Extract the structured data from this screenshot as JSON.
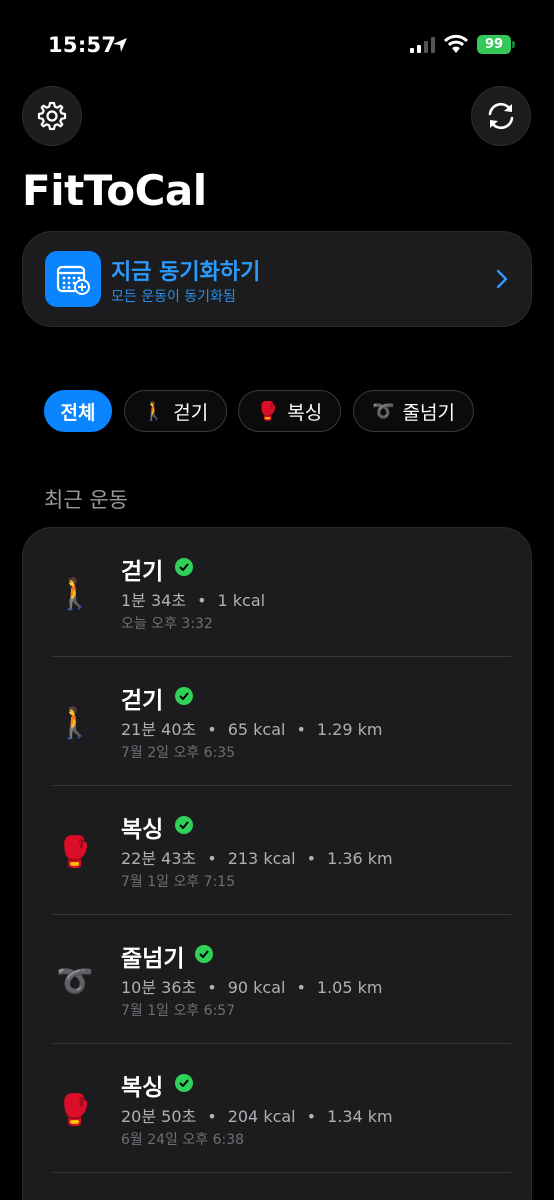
{
  "status_bar": {
    "time": "15:57",
    "battery": "99"
  },
  "header": {
    "title": "FitToCal",
    "settings_icon": "gear-icon",
    "sync_icon": "refresh-icon"
  },
  "sync_card": {
    "title": "지금 동기화하기",
    "subtitle": "모든 운동이 동기화됨",
    "icon": "calendar-plus-icon"
  },
  "filters": [
    {
      "label": "전체",
      "emoji": "",
      "active": true
    },
    {
      "label": "걷기",
      "emoji": "🚶",
      "active": false
    },
    {
      "label": "복싱",
      "emoji": "🥊",
      "active": false
    },
    {
      "label": "줄넘기",
      "emoji": "➰",
      "active": false
    }
  ],
  "section_title": "최근 운동",
  "workouts": [
    {
      "name": "걷기",
      "emoji": "🚶",
      "duration": "1분 34초",
      "kcal": "1 kcal",
      "distance": "",
      "time": "오늘 오후 3:32"
    },
    {
      "name": "걷기",
      "emoji": "🚶",
      "duration": "21분 40초",
      "kcal": "65 kcal",
      "distance": "1.29 km",
      "time": "7월 2일 오후 6:35"
    },
    {
      "name": "복싱",
      "emoji": "🥊",
      "duration": "22분 43초",
      "kcal": "213 kcal",
      "distance": "1.36 km",
      "time": "7월 1일 오후 7:15"
    },
    {
      "name": "줄넘기",
      "emoji": "➰",
      "duration": "10분 36초",
      "kcal": "90 kcal",
      "distance": "1.05 km",
      "time": "7월 1일 오후 6:57"
    },
    {
      "name": "복싱",
      "emoji": "🥊",
      "duration": "20분 50초",
      "kcal": "204 kcal",
      "distance": "1.34 km",
      "time": "6월 24일 오후 6:38"
    }
  ],
  "colors": {
    "accent": "#0a84ff",
    "success": "#30d158",
    "card": "#1c1c1e"
  }
}
